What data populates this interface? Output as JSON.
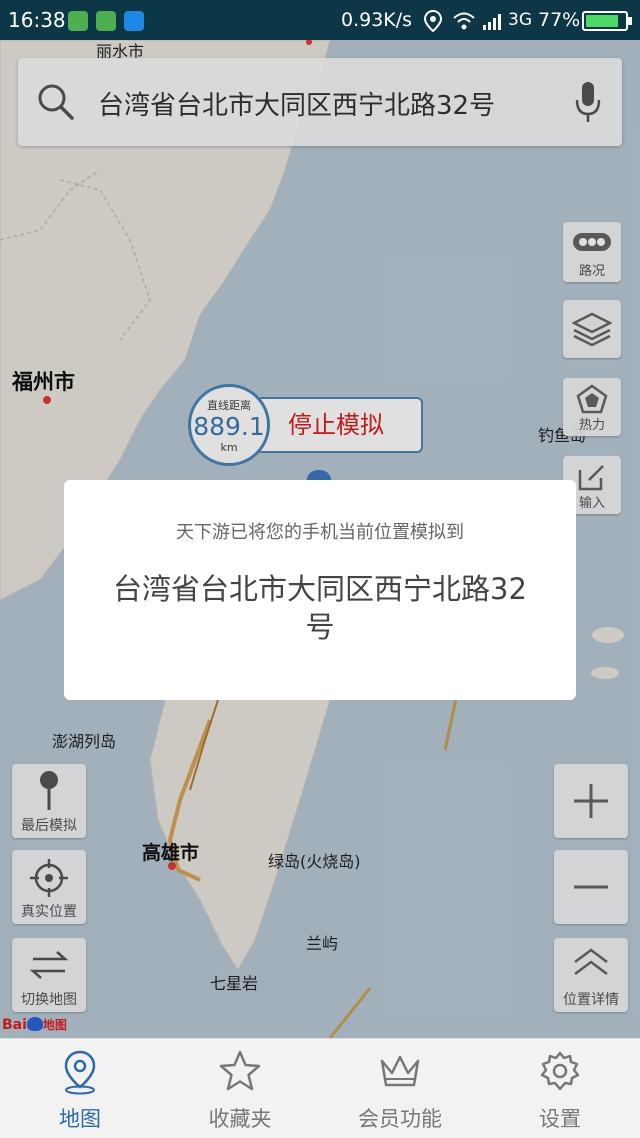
{
  "status_bar": {
    "time": "16:38",
    "speed": "0.93K/s",
    "network": "3G",
    "battery": "77%"
  },
  "search": {
    "query": "台湾省台北市大同区西宁北路32号"
  },
  "map_labels": {
    "top_city": "丽水市",
    "fuzhou": "福州市",
    "diaoyu": "钓鱼岛",
    "penghu": "澎湖列岛",
    "kaohsiung": "高雄市",
    "lvdao": "绿岛(火烧岛)",
    "lanyu": "兰屿",
    "qixingyan": "七星岩"
  },
  "right_tools": {
    "traffic": "路况",
    "heat": "热力",
    "input": "输入",
    "detail": "位置详情"
  },
  "left_tools": {
    "last_sim": "最后模拟",
    "real_pos": "真实位置",
    "switch_map": "切换地图"
  },
  "distance": {
    "title": "直线距离",
    "value": "889.1",
    "unit": "km"
  },
  "stop_button": "停止模拟",
  "dialog": {
    "message": "天下游已将您的手机当前位置模拟到",
    "address": "台湾省台北市大同区西宁北路32号"
  },
  "map_brand": "地图",
  "bottom_nav": [
    {
      "label": "地图",
      "icon": "map-pin-icon",
      "active": true
    },
    {
      "label": "收藏夹",
      "icon": "star-icon",
      "active": false
    },
    {
      "label": "会员功能",
      "icon": "crown-icon",
      "active": false
    },
    {
      "label": "设置",
      "icon": "gear-icon",
      "active": false
    }
  ],
  "colors": {
    "accent": "#2d6aa8",
    "stop_red": "#d6201f",
    "statusbar": "#0d3646",
    "sea": "#b9c9d6",
    "land": "#e9e6df"
  }
}
